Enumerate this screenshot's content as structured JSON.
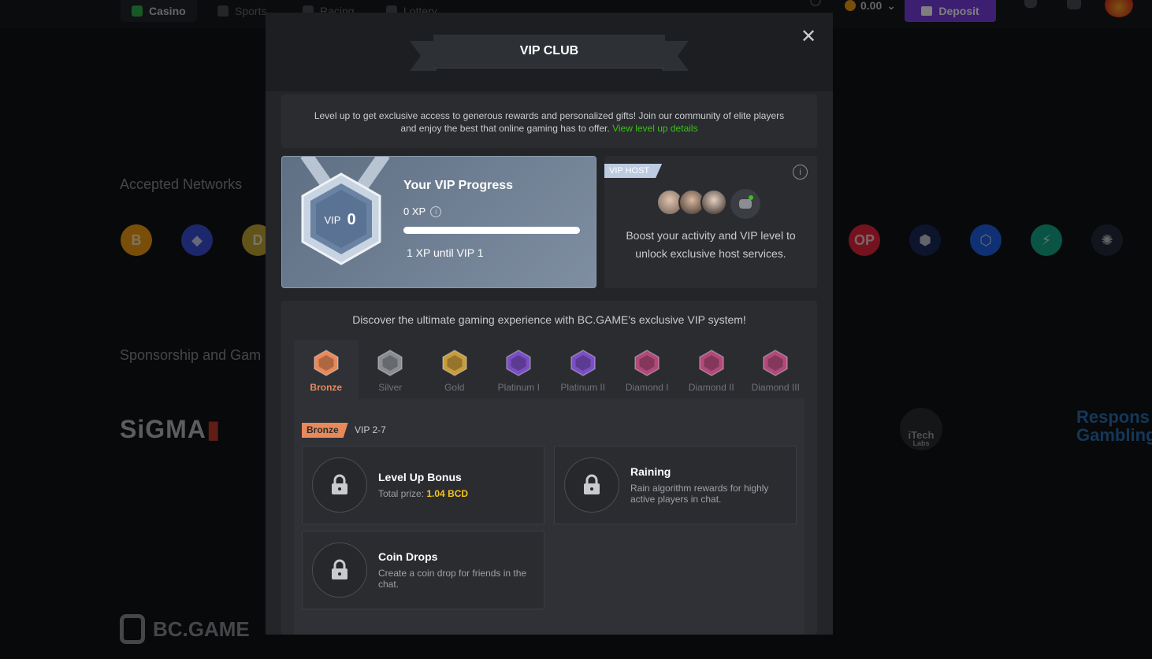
{
  "background": {
    "nav": [
      "Casino",
      "Sports",
      "Racing",
      "Lottery"
    ],
    "balance": "0.00",
    "deposit_label": "Deposit",
    "accepted_networks_heading": "Accepted Networks",
    "sponsorship_heading": "Sponsorship and Gam",
    "networks": [
      {
        "name": "bitcoin-icon",
        "glyph": "B",
        "color": "#f39c12"
      },
      {
        "name": "ethereum-icon",
        "glyph": "◆",
        "color": "#3b4fd8"
      },
      {
        "name": "dogecoin-icon",
        "glyph": "D",
        "color": "#c2a633"
      },
      {
        "name": "optimism-icon",
        "glyph": "OP",
        "color": "#e8263c"
      },
      {
        "name": "cronos-icon",
        "glyph": "⬢",
        "color": "#1a2a5a"
      },
      {
        "name": "fantom-icon",
        "glyph": "⬡",
        "color": "#2060e8"
      },
      {
        "name": "bolt-icon",
        "glyph": "⚡",
        "color": "#15a88a"
      },
      {
        "name": "cosmos-icon",
        "glyph": "✺",
        "color": "#262a3c"
      }
    ],
    "sigma_logo": "SiGMA",
    "itech_logo": "iTech",
    "itech_sub": "Labs",
    "responsible_line1": "Respons",
    "responsible_line2": "Gambling",
    "footer_logo": "BC.GAME"
  },
  "modal": {
    "title": "VIP CLUB",
    "close_glyph": "✕",
    "intro_text": "Level up to get exclusive access to generous rewards and personalized gifts! Join our community of elite players and enjoy the best that online gaming has to offer.",
    "intro_link": "View level up details",
    "progress": {
      "title": "Your VIP Progress",
      "vip_prefix": "VIP",
      "vip_level": "0",
      "xp": "0 XP",
      "until": "1 XP until VIP 1",
      "fraction": 0
    },
    "host": {
      "tag": "VIP HOST",
      "info_glyph": "i",
      "text": "Boost your activity and VIP level to unlock exclusive host services."
    },
    "discover": "Discover the ultimate gaming experience with BC.GAME's exclusive VIP system!",
    "tiers": [
      {
        "label": "Bronze",
        "color": "#e8895a"
      },
      {
        "label": "Silver",
        "color": "#8a8d92"
      },
      {
        "label": "Gold",
        "color": "#c89b3c"
      },
      {
        "label": "Platinum I",
        "color": "#7b4fc4"
      },
      {
        "label": "Platinum II",
        "color": "#7b4fc4"
      },
      {
        "label": "Diamond I",
        "color": "#b04a7a"
      },
      {
        "label": "Diamond II",
        "color": "#b04a7a"
      },
      {
        "label": "Diamond III",
        "color": "#b04a7a"
      }
    ],
    "selected_tier": "Bronze",
    "vip_range": "VIP 2-7",
    "perks": {
      "level_up": {
        "title": "Level Up Bonus",
        "desc_prefix": "Total prize:",
        "prize": "1.04 BCD"
      },
      "raining": {
        "title": "Raining",
        "desc": "Rain algorithm rewards for highly active players in chat."
      },
      "coin_drops": {
        "title": "Coin Drops",
        "desc": "Create a coin drop for friends in the chat."
      }
    }
  }
}
